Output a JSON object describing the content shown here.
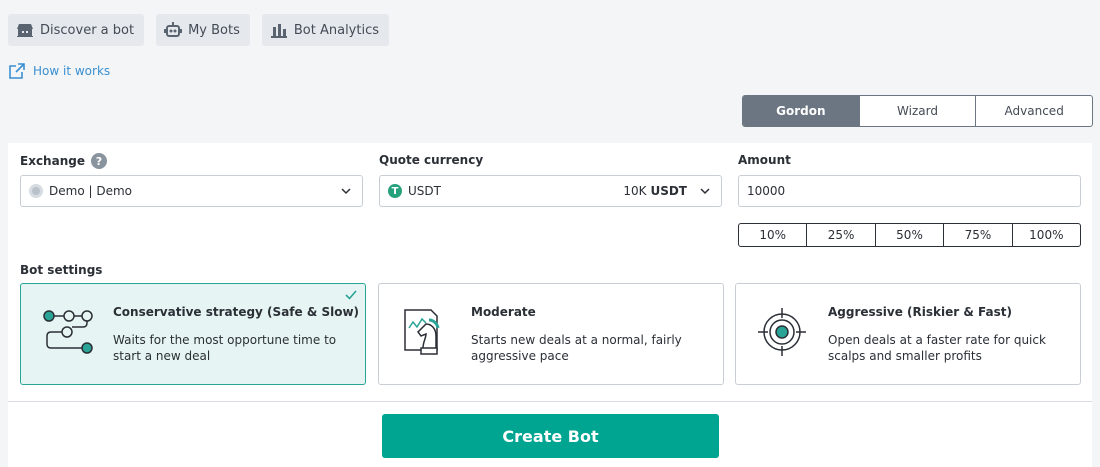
{
  "nav": {
    "discover": {
      "label": "Discover a bot",
      "icon": "bot-shop-icon"
    },
    "mybots": {
      "label": "My Bots",
      "icon": "robot-icon"
    },
    "analytics": {
      "label": "Bot Analytics",
      "icon": "analytics-icon"
    }
  },
  "how_it_works": {
    "label": "How it works",
    "icon": "external-link-icon"
  },
  "modes": [
    {
      "label": "Gordon",
      "active": true
    },
    {
      "label": "Wizard",
      "active": false
    },
    {
      "label": "Advanced",
      "active": false
    }
  ],
  "exchange": {
    "label": "Exchange",
    "help": "?",
    "value": "Demo | Demo"
  },
  "quote_currency": {
    "label": "Quote currency",
    "value": "USDT",
    "balance": "10K",
    "balance_unit": "USDT"
  },
  "amount": {
    "label": "Amount",
    "value": "10000"
  },
  "percentages": [
    "10%",
    "25%",
    "50%",
    "75%",
    "100%"
  ],
  "bot_settings": {
    "label": "Bot settings",
    "options": [
      {
        "title": "Conservative strategy (Safe & Slow)",
        "desc": "Waits for the most opportune time to start a new deal",
        "selected": true,
        "icon": "strategy-flow-icon"
      },
      {
        "title": "Moderate",
        "desc": "Starts new deals at a normal, fairly aggressive pace",
        "selected": false,
        "icon": "chess-knight-icon"
      },
      {
        "title": "Aggressive (Riskier & Fast)",
        "desc": "Open deals at a faster rate for quick scalps and smaller profits",
        "selected": false,
        "icon": "target-icon"
      }
    ]
  },
  "create_button": {
    "label": "Create Bot"
  },
  "colors": {
    "accent": "#00a592",
    "selected_bg": "#e6f5f3",
    "segment_active": "#6b7682",
    "link": "#3b8fd1",
    "usdt": "#26a17b"
  }
}
